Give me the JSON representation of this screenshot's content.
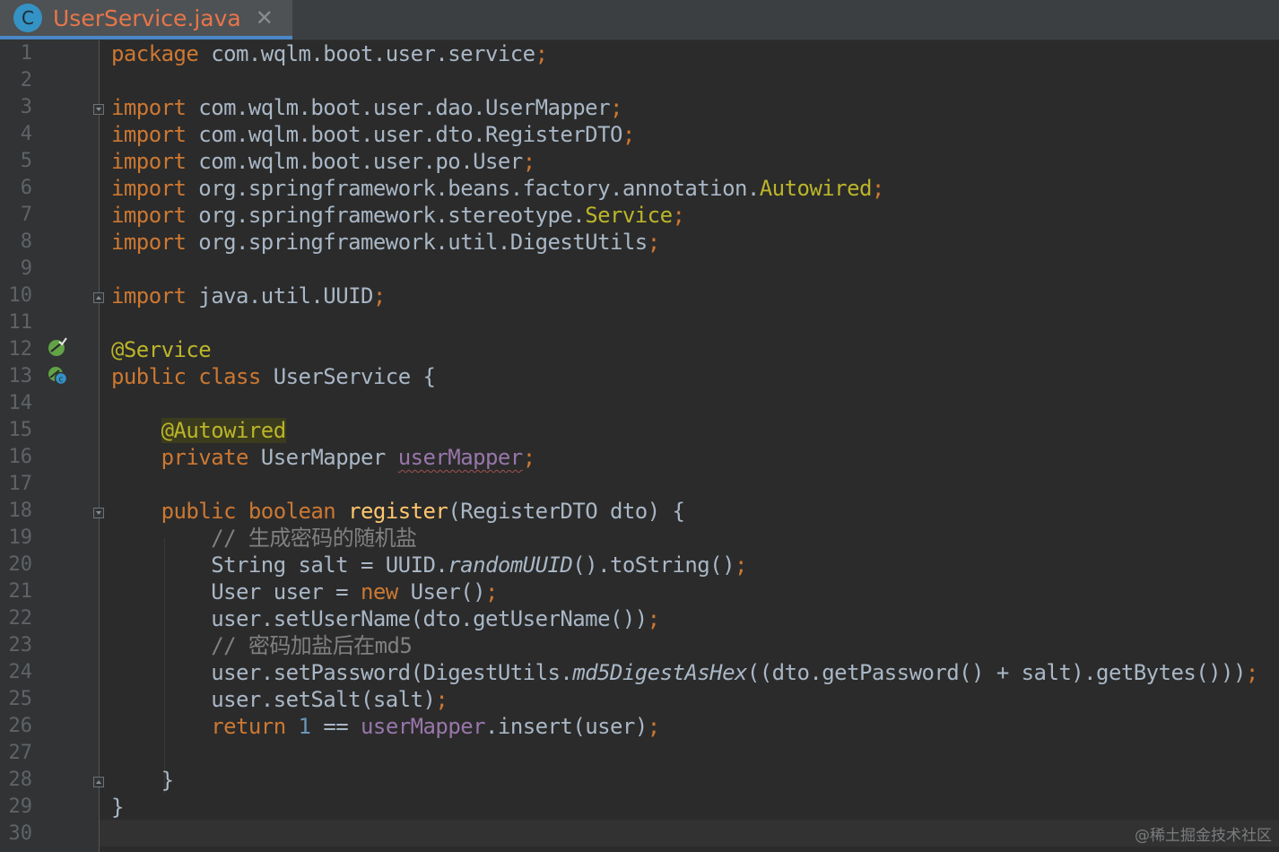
{
  "tab": {
    "icon_letter": "C",
    "title": "UserService.java",
    "close_glyph": "✕"
  },
  "lines": [
    {
      "num": "1",
      "tokens": [
        {
          "t": "package",
          "c": "kw"
        },
        {
          "t": " com.wqlm.boot.user.service"
        },
        {
          "t": ";",
          "c": "kw"
        }
      ]
    },
    {
      "num": "2",
      "tokens": []
    },
    {
      "num": "3",
      "tokens": [
        {
          "t": "import",
          "c": "kw"
        },
        {
          "t": " com.wqlm.boot.user.dao.UserMapper"
        },
        {
          "t": ";",
          "c": "kw"
        }
      ]
    },
    {
      "num": "4",
      "tokens": [
        {
          "t": "import",
          "c": "kw"
        },
        {
          "t": " com.wqlm.boot.user.dto.RegisterDTO"
        },
        {
          "t": ";",
          "c": "kw"
        }
      ]
    },
    {
      "num": "5",
      "tokens": [
        {
          "t": "import",
          "c": "kw"
        },
        {
          "t": " com.wqlm.boot.user.po.User"
        },
        {
          "t": ";",
          "c": "kw"
        }
      ]
    },
    {
      "num": "6",
      "tokens": [
        {
          "t": "import",
          "c": "kw"
        },
        {
          "t": " org.springframework.beans.factory.annotation."
        },
        {
          "t": "Autowired",
          "c": "ann"
        },
        {
          "t": ";",
          "c": "kw"
        }
      ]
    },
    {
      "num": "7",
      "tokens": [
        {
          "t": "import",
          "c": "kw"
        },
        {
          "t": " org.springframework.stereotype."
        },
        {
          "t": "Service",
          "c": "ann"
        },
        {
          "t": ";",
          "c": "kw"
        }
      ]
    },
    {
      "num": "8",
      "tokens": [
        {
          "t": "import",
          "c": "kw"
        },
        {
          "t": " org.springframework.util.DigestUtils"
        },
        {
          "t": ";",
          "c": "kw"
        }
      ]
    },
    {
      "num": "9",
      "tokens": []
    },
    {
      "num": "10",
      "tokens": [
        {
          "t": "import",
          "c": "kw"
        },
        {
          "t": " java.util.UUID"
        },
        {
          "t": ";",
          "c": "kw"
        }
      ]
    },
    {
      "num": "11",
      "tokens": []
    },
    {
      "num": "12",
      "tokens": [
        {
          "t": "@Service",
          "c": "ann"
        }
      ]
    },
    {
      "num": "13",
      "tokens": [
        {
          "t": "public class",
          "c": "kw"
        },
        {
          "t": " UserService {"
        }
      ]
    },
    {
      "num": "14",
      "tokens": []
    },
    {
      "num": "15",
      "tokens": [
        {
          "t": "    "
        },
        {
          "t": "@Autowired",
          "c": "ann-hl"
        }
      ]
    },
    {
      "num": "16",
      "tokens": [
        {
          "t": "    "
        },
        {
          "t": "private",
          "c": "kw"
        },
        {
          "t": " UserMapper "
        },
        {
          "t": "userMapper",
          "c": "wavy"
        },
        {
          "t": ";",
          "c": "kw"
        }
      ]
    },
    {
      "num": "17",
      "tokens": []
    },
    {
      "num": "18",
      "tokens": [
        {
          "t": "    "
        },
        {
          "t": "public boolean",
          "c": "kw"
        },
        {
          "t": " "
        },
        {
          "t": "register",
          "c": "fn"
        },
        {
          "t": "(RegisterDTO dto) {"
        }
      ]
    },
    {
      "num": "19",
      "tokens": [
        {
          "t": "        "
        },
        {
          "t": "// 生成密码的随机盐",
          "c": "cm"
        }
      ]
    },
    {
      "num": "20",
      "tokens": [
        {
          "t": "        String salt = UUID."
        },
        {
          "t": "randomUUID",
          "c": "it"
        },
        {
          "t": "().toString()"
        },
        {
          "t": ";",
          "c": "kw"
        }
      ]
    },
    {
      "num": "21",
      "tokens": [
        {
          "t": "        User user = "
        },
        {
          "t": "new",
          "c": "kw"
        },
        {
          "t": " User()"
        },
        {
          "t": ";",
          "c": "kw"
        }
      ]
    },
    {
      "num": "22",
      "tokens": [
        {
          "t": "        user.setUserName(dto.getUserName())"
        },
        {
          "t": ";",
          "c": "kw"
        }
      ]
    },
    {
      "num": "23",
      "tokens": [
        {
          "t": "        "
        },
        {
          "t": "// 密码加盐后在md5",
          "c": "cm"
        }
      ]
    },
    {
      "num": "24",
      "tokens": [
        {
          "t": "        user.setPassword(DigestUtils."
        },
        {
          "t": "md5DigestAsHex",
          "c": "it"
        },
        {
          "t": "((dto.getPassword() + salt).getBytes()))"
        },
        {
          "t": ";",
          "c": "kw"
        }
      ]
    },
    {
      "num": "25",
      "tokens": [
        {
          "t": "        user.setSalt(salt)"
        },
        {
          "t": ";",
          "c": "kw"
        }
      ]
    },
    {
      "num": "26",
      "tokens": [
        {
          "t": "        "
        },
        {
          "t": "return",
          "c": "kw"
        },
        {
          "t": " "
        },
        {
          "t": "1",
          "c": "num"
        },
        {
          "t": " == "
        },
        {
          "t": "userMapper",
          "c": "fld"
        },
        {
          "t": ".insert(user)"
        },
        {
          "t": ";",
          "c": "kw"
        }
      ]
    },
    {
      "num": "27",
      "tokens": []
    },
    {
      "num": "28",
      "tokens": [
        {
          "t": "    }"
        }
      ]
    },
    {
      "num": "29",
      "tokens": [
        {
          "t": "}"
        }
      ]
    },
    {
      "num": "30",
      "tokens": []
    }
  ],
  "watermark": "@稀土掘金技术社区",
  "icons": {
    "tab": "java-class-icon",
    "line12": "spring-bean-icon",
    "line13": "spring-bean-class-icon"
  }
}
